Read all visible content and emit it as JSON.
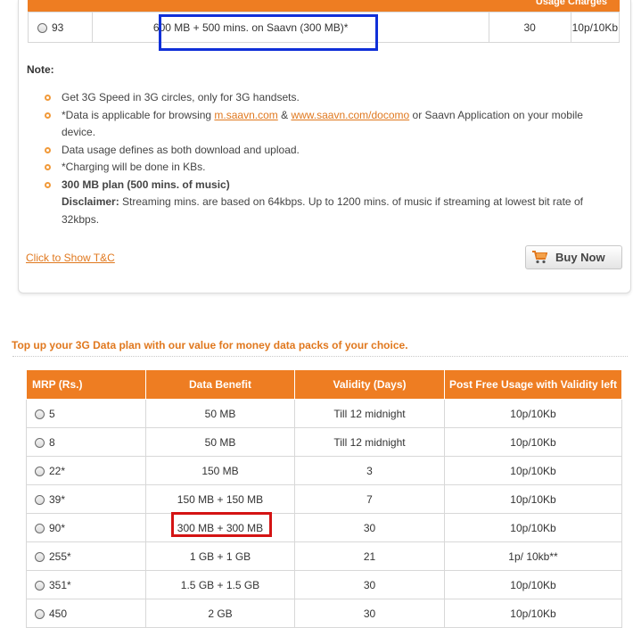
{
  "top_plan": {
    "header_fragment": "Usage Charges",
    "row": {
      "id": "93",
      "benefit": "600 MB + 500 mins. on Saavn (300 MB)*",
      "validity": "30",
      "usage": "10p/10Kb"
    }
  },
  "notes": {
    "title": "Note:",
    "item1": "Get 3G Speed in 3G circles, only for 3G handsets.",
    "item2_pre": "*Data is applicable for browsing ",
    "item2_link1": "m.saavn.com",
    "item2_mid": " & ",
    "item2_link2": "www.saavn.com/docomo",
    "item2_post": " or Saavn Application on your mobile device.",
    "item3": "Data usage defines as both download and upload.",
    "item4": "*Charging will be done in KBs.",
    "item5_bold": "300 MB plan (500 mins. of music)",
    "disclaimer_label": "Disclaimer:",
    "disclaimer_text": " Streaming mins. are based on 64kbps. Up to 1200 mins. of music if streaming at lowest bit rate of 32kbps."
  },
  "tc_link": "Click to Show T&C",
  "buy_button": "Buy Now",
  "section_title": "Top up your 3G Data plan with our value for money data packs of your choice.",
  "table": {
    "headers": [
      "MRP (Rs.)",
      "Data Benefit",
      "Validity (Days)",
      "Post Free Usage with Validity left"
    ],
    "rows": [
      [
        "5",
        "50 MB",
        "Till 12 midnight",
        "10p/10Kb"
      ],
      [
        "8",
        "50 MB",
        "Till 12 midnight",
        "10p/10Kb"
      ],
      [
        "22*",
        "150  MB",
        "3",
        "10p/10Kb"
      ],
      [
        "39*",
        "150  MB + 150 MB",
        "7",
        "10p/10Kb"
      ],
      [
        "90*",
        "300 MB + 300 MB",
        "30",
        "10p/10Kb"
      ],
      [
        "255*",
        "1 GB + 1 GB",
        "21",
        "1p/ 10kb**"
      ],
      [
        "351*",
        "1.5 GB + 1.5 GB",
        "30",
        "10p/10Kb"
      ],
      [
        "450",
        "2 GB",
        "30",
        "10p/10Kb"
      ]
    ]
  },
  "colors": {
    "accent": "#ee7d22",
    "link": "#e0781e",
    "highlight_blue": "#1030d8",
    "highlight_red": "#d41414"
  }
}
